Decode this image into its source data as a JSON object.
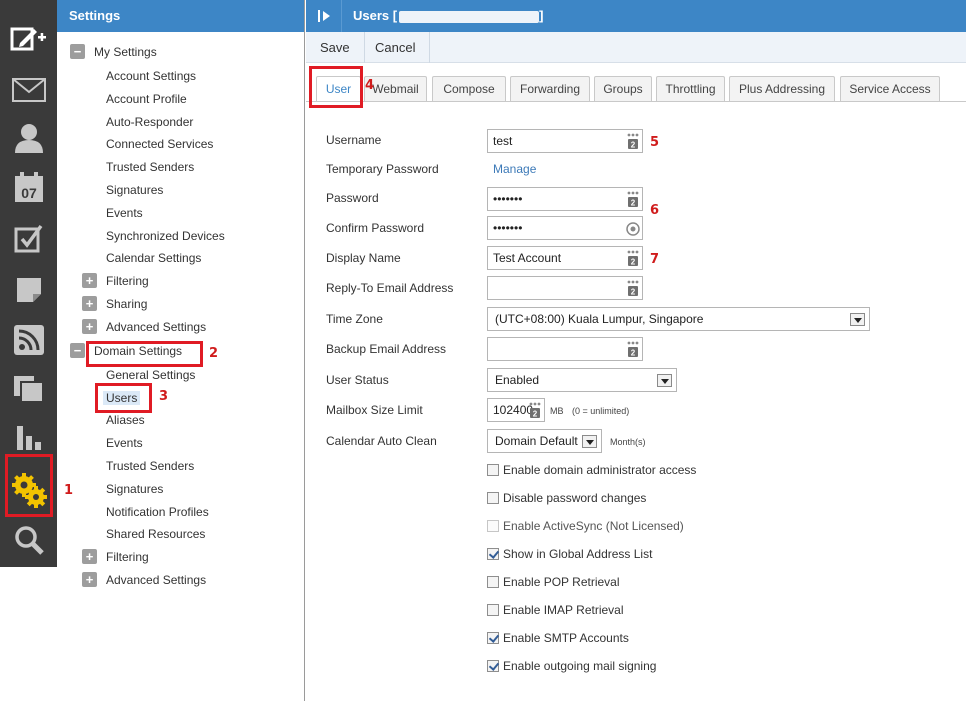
{
  "rail": {
    "icons": [
      "compose-new-icon",
      "mail-icon",
      "contacts-icon",
      "calendar-icon",
      "tasks-icon",
      "notes-icon",
      "rss-icon",
      "files-icon",
      "reports-icon",
      "settings-gears-icon",
      "search-icon"
    ],
    "calendar_day": "07"
  },
  "tree": {
    "header": "Settings",
    "my_settings": {
      "label": "My Settings",
      "items": [
        "Account Settings",
        "Account Profile",
        "Auto-Responder",
        "Connected Services",
        "Trusted Senders",
        "Signatures",
        "Events",
        "Synchronized Devices",
        "Calendar Settings"
      ],
      "groups": [
        "Filtering",
        "Sharing",
        "Advanced Settings"
      ]
    },
    "domain_settings": {
      "label": "Domain Settings",
      "items": [
        "General Settings",
        "Users",
        "Aliases",
        "Events",
        "Trusted Senders",
        "Signatures",
        "Notification Profiles",
        "Shared Resources"
      ],
      "groups": [
        "Filtering",
        "Advanced Settings"
      ]
    }
  },
  "main": {
    "title": "Users",
    "toolbar": {
      "save": "Save",
      "cancel": "Cancel"
    },
    "tabs": [
      "User",
      "Webmail",
      "Compose",
      "Forwarding",
      "Groups",
      "Throttling",
      "Plus Addressing",
      "Service Access"
    ],
    "active_tab": "User",
    "form": {
      "username_label": "Username",
      "username_value": "test",
      "temp_password_label": "Temporary Password",
      "temp_password_link": "Manage",
      "password_label": "Password",
      "password_value": "•••••••",
      "confirm_label": "Confirm Password",
      "confirm_value": "•••••••",
      "display_name_label": "Display Name",
      "display_name_value": "Test Account",
      "reply_to_label": "Reply-To Email Address",
      "reply_to_value": "",
      "time_zone_label": "Time Zone",
      "time_zone_value": "(UTC+08:00) Kuala Lumpur, Singapore",
      "backup_email_label": "Backup Email Address",
      "backup_email_value": "",
      "user_status_label": "User Status",
      "user_status_value": "Enabled",
      "mailbox_label": "Mailbox Size Limit",
      "mailbox_value": "102400",
      "mailbox_unit": "MB",
      "mailbox_hint": "(0 = unlimited)",
      "cal_clean_label": "Calendar Auto Clean",
      "cal_clean_value": "Domain Default",
      "cal_clean_unit": "Month(s)"
    },
    "checkboxes": [
      {
        "label": "Enable domain administrator access",
        "checked": false,
        "disabled": false
      },
      {
        "label": "Disable password changes",
        "checked": false,
        "disabled": false
      },
      {
        "label": "Enable ActiveSync (Not Licensed)",
        "checked": false,
        "disabled": true
      },
      {
        "label": "Show in Global Address List",
        "checked": true,
        "disabled": false
      },
      {
        "label": "Enable POP Retrieval",
        "checked": false,
        "disabled": false
      },
      {
        "label": "Enable IMAP Retrieval",
        "checked": false,
        "disabled": false
      },
      {
        "label": "Enable SMTP Accounts",
        "checked": true,
        "disabled": false
      },
      {
        "label": "Enable outgoing mail signing",
        "checked": true,
        "disabled": false
      }
    ]
  },
  "annotations": [
    "1",
    "2",
    "3",
    "4",
    "5",
    "6",
    "7"
  ],
  "colors": {
    "header_blue": "#3d86c6",
    "rail_dark": "#3a3a3a",
    "annotation_red": "#e01b24",
    "settings_gear_yellow": "#f2c300"
  }
}
